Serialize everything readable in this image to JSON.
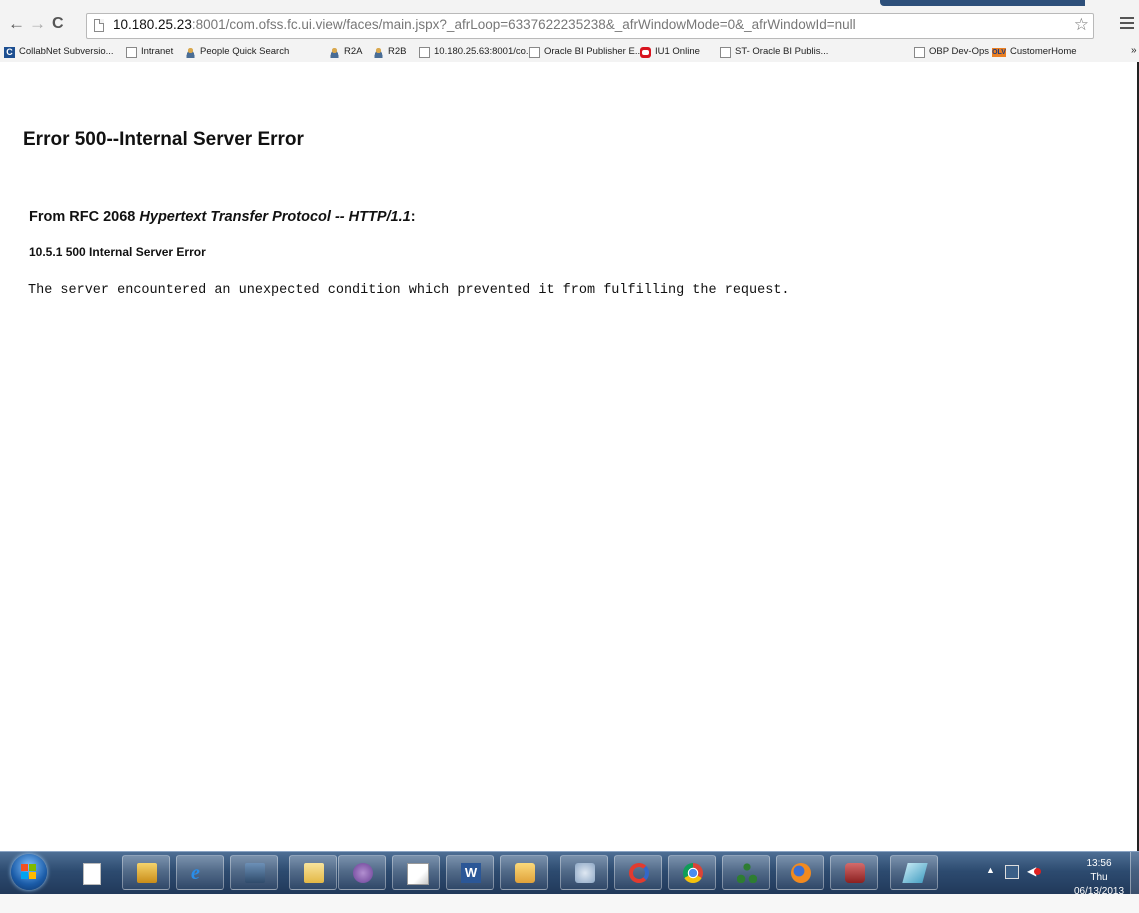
{
  "browser": {
    "nav": {
      "back": "←",
      "forward": "→",
      "reload": "C"
    },
    "address": {
      "host": "10.180.25.23",
      "rest": ":8001/com.ofss.fc.ui.view/faces/main.jspx?_afrLoop=6337622235238&_afrWindowMode=0&_afrWindowId=null"
    },
    "star": "☆",
    "bookmarks": [
      {
        "label": "CollabNet Subversio...",
        "icon": "collabnet-icon"
      },
      {
        "label": "Intranet",
        "icon": "page-icon"
      },
      {
        "label": "People Quick Search",
        "icon": "person-icon"
      },
      {
        "label": "R2A",
        "icon": "person-icon"
      },
      {
        "label": "R2B",
        "icon": "person-icon"
      },
      {
        "label": "10.180.25.63:8001/co...",
        "icon": "page-icon"
      },
      {
        "label": "Oracle BI Publisher E...",
        "icon": "page-icon"
      },
      {
        "label": "IU1 Online",
        "icon": "oracle-icon"
      },
      {
        "label": "ST- Oracle BI Publis...",
        "icon": "page-icon"
      },
      {
        "label": "OBP Dev-Ops",
        "icon": "page-icon"
      },
      {
        "label": "CustomerHome",
        "icon": "olv-icon",
        "badge": "OLV"
      }
    ],
    "more": "»"
  },
  "page": {
    "title": "Error 500--Internal Server Error",
    "rfc_prefix": "From RFC 2068 ",
    "rfc_italic": "Hypertext Transfer Protocol -- HTTP/1.1",
    "rfc_suffix": ":",
    "section": "10.5.1 500 Internal Server Error",
    "message": "The server encountered an unexpected condition which prevented it from fulfilling the request."
  },
  "taskbar": {
    "start": "windows-start-icon",
    "apps": [
      "blank-document-icon",
      "remote-desktop-icon",
      "internet-explorer-icon",
      "security-icon",
      "file-explorer-icon",
      "chat-icon",
      "notepad-icon",
      "word-icon",
      "outlook-icon",
      "network-tool-icon",
      "refresh-app-icon",
      "chrome-icon",
      "org-chart-icon",
      "firefox-icon",
      "database-icon",
      "editor-icon"
    ],
    "clock": {
      "time": "13:56",
      "date": "Thu 06/13/2013"
    },
    "tray_arrow": "▲"
  }
}
